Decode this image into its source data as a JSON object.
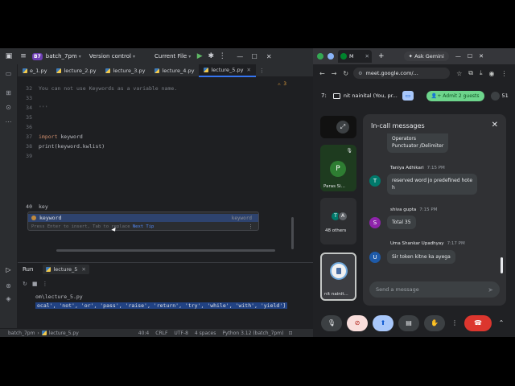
{
  "ide": {
    "project_badge": "B7",
    "project_name": "batch_7pm",
    "vcs": "Version control",
    "run_config": "Current File",
    "tabs": [
      {
        "label": "e_1.py",
        "active": false
      },
      {
        "label": "lecture_2.py",
        "active": false
      },
      {
        "label": "lecture_3.py",
        "active": false
      },
      {
        "label": "lecture_4.py",
        "active": false
      },
      {
        "label": "lecture_5.py",
        "active": true
      }
    ],
    "gutter": [
      "32",
      "33",
      "34",
      "35",
      "36",
      "37",
      "38",
      "39",
      "40"
    ],
    "warn_count": "3",
    "code": {
      "comment_line": "You can not use Keywords as a variable name.",
      "triple_quote": "'''",
      "import_kw": "import",
      "import_mod": " keyword",
      "print_line": "print(keyword.kwlist)",
      "typed": "key"
    },
    "autocomplete": {
      "item": "keyword",
      "item_type": "keyword",
      "hint": "Press Enter to insert, Tab to replace",
      "next_tip": "Next Tip"
    },
    "run": {
      "label": "Run",
      "tab": "lecture_5",
      "output_path": "om\\lecture_5.py",
      "output_list": "ocal', 'not', 'or', 'pass', 'raise', 'return', 'try', 'while', 'with', 'yield']"
    },
    "status": {
      "project": "batch_7pm",
      "file": "lecture_5.py",
      "position": "40:4",
      "line_sep": "CRLF",
      "encoding": "UTF-8",
      "indent": "4 spaces",
      "interpreter": "Python 3.12 (batch_7pm)"
    }
  },
  "browser": {
    "tab_title": "M",
    "ask_gemini": "Ask Gemini",
    "url": "meet.google.com/..."
  },
  "meet": {
    "time": "7:",
    "meeting_title": "nit nainital (You, pr...",
    "admit_label": "Admit 2 guests",
    "people_count": "51",
    "tiles": {
      "paras_initial": "P",
      "paras_name": "Paras Si...",
      "others_initials": [
        "T",
        "A"
      ],
      "others_label": "48 others",
      "nainital_name": "nit nainit..."
    },
    "chat": {
      "title": "In-call messages",
      "partial_lines": [
        "Operators",
        "Punctuator /Delimiter"
      ],
      "messages": [
        {
          "sender": "Taniya Adhikari",
          "time": "7:15 PM",
          "initial": "T",
          "color": "#00796b",
          "text_lines": [
            "reserved word jo predefined hote",
            "h"
          ]
        },
        {
          "sender": "shiva gupta",
          "time": "7:15 PM",
          "initial": "S",
          "color": "#8e24aa",
          "text_lines": [
            "Total 35"
          ]
        },
        {
          "sender": "Uma Shankar Upadhyay",
          "time": "7:17 PM",
          "initial": "U",
          "color": "#1e5aa8",
          "text_lines": [
            "Sir token kitne ka ayega"
          ]
        }
      ],
      "input_placeholder": "Send a message"
    }
  },
  "colors": {
    "ide_bg": "#1e1f22",
    "ide_accent": "#3574f0",
    "meet_bg": "#202124",
    "admit_green": "#6dd58c",
    "leave_red": "#dc362e"
  }
}
